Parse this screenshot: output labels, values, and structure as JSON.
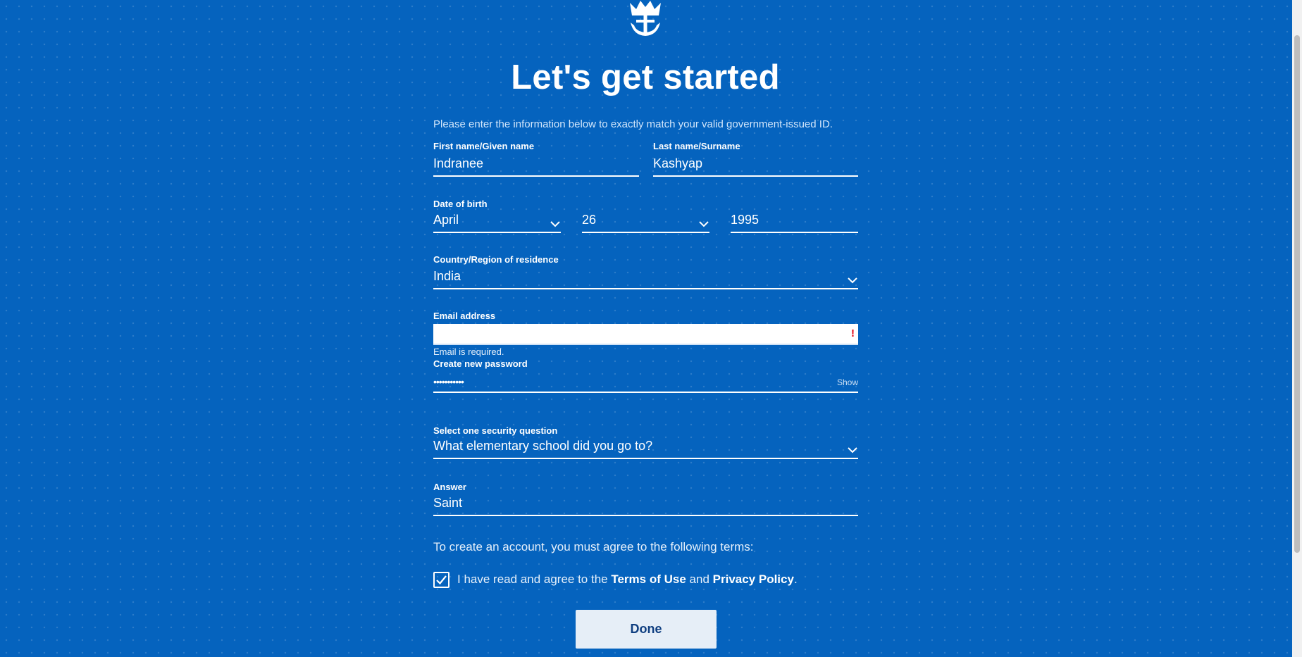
{
  "page": {
    "title": "Let's get started",
    "intro": "Please enter the information below to exactly match your valid government-issued ID."
  },
  "form": {
    "first_name": {
      "label": "First name/Given name",
      "value": "Indranee"
    },
    "last_name": {
      "label": "Last name/Surname",
      "value": "Kashyap"
    },
    "dob": {
      "label": "Date of birth",
      "month": "April",
      "day": "26",
      "year": "1995"
    },
    "country": {
      "label": "Country/Region of residence",
      "value": "India"
    },
    "email": {
      "label": "Email address",
      "value": "",
      "error": "Email is required.",
      "error_icon": "!"
    },
    "password": {
      "label": "Create new password",
      "masked_value": "•••••••••••",
      "show_label": "Show"
    },
    "security_question": {
      "label": "Select one security question",
      "value": "What elementary school did you go to?"
    },
    "answer": {
      "label": "Answer",
      "value": "Saint"
    }
  },
  "terms": {
    "intro": "To create an account, you must agree to the following terms:",
    "checked": true,
    "prefix": "I have read and agree to the",
    "terms_link": "Terms of Use",
    "and": "and",
    "privacy_link": "Privacy Policy",
    "suffix": "."
  },
  "actions": {
    "done_label": "Done"
  },
  "icons": {
    "logo": "crown-anchor-logo",
    "dropdown": "chevron-down-icon",
    "error": "exclamation-icon",
    "check": "checkmark-icon"
  },
  "colors": {
    "background": "#0563be",
    "error": "#e00010",
    "button_bg": "#e6eef7",
    "button_text": "#0f3e80"
  }
}
